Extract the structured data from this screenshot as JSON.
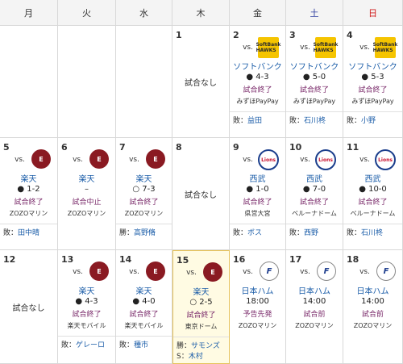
{
  "days": [
    "月",
    "火",
    "水",
    "木",
    "金",
    "土",
    "日"
  ],
  "day_colors": [
    "#333333",
    "#333333",
    "#333333",
    "#333333",
    "#333333",
    "#2f3fa0",
    "#d11b1b"
  ],
  "weeks": [
    [
      {
        "empty": true
      },
      {
        "empty": true
      },
      {
        "empty": true
      },
      {
        "day": "1",
        "none": "試合なし"
      },
      {
        "day": "2",
        "logo": "hawks",
        "logo_text": "SoftBank HAWKS",
        "vs": "vs.",
        "opp": "ソフトバンク",
        "score": "● 4-3",
        "status": "試合終了",
        "stadium": "みずほPayPay",
        "pitcher_label": "敗：",
        "pitcher": "益田"
      },
      {
        "day": "3",
        "logo": "hawks",
        "logo_text": "SoftBank HAWKS",
        "vs": "vs.",
        "opp": "ソフトバンク",
        "score": "● 5-0",
        "status": "試合終了",
        "stadium": "みずほPayPay",
        "pitcher_label": "敗：",
        "pitcher": "石川柊"
      },
      {
        "day": "4",
        "logo": "hawks",
        "logo_text": "SoftBank HAWKS",
        "vs": "vs.",
        "opp": "ソフトバンク",
        "score": "● 5-3",
        "status": "試合終了",
        "stadium": "みずほPayPay",
        "pitcher_label": "敗：",
        "pitcher": "小野"
      }
    ],
    [
      {
        "day": "5",
        "logo": "eagles",
        "logo_text": "E",
        "vs": "vs.",
        "opp": "楽天",
        "score": "● 1-2",
        "status": "試合終了",
        "stadium": "ZOZOマリン",
        "pitcher_label": "敗：",
        "pitcher": "田中晴"
      },
      {
        "day": "6",
        "logo": "eagles",
        "logo_text": "E",
        "vs": "vs.",
        "opp": "楽天",
        "score": "–",
        "status": "試合中止",
        "stadium": "ZOZOマリン"
      },
      {
        "day": "7",
        "logo": "eagles",
        "logo_text": "E",
        "vs": "vs.",
        "opp": "楽天",
        "score": "○ 7-3",
        "status": "試合終了",
        "stadium": "ZOZOマリン",
        "pitcher_label": "勝：",
        "pitcher": "高野脩"
      },
      {
        "day": "8",
        "none": "試合なし"
      },
      {
        "day": "9",
        "logo": "lions",
        "logo_text": "Lions",
        "vs": "vs.",
        "opp": "西武",
        "score": "● 1-0",
        "status": "試合終了",
        "stadium": "県営大宮",
        "pitcher_label": "敗：",
        "pitcher": "ボス"
      },
      {
        "day": "10",
        "logo": "lions",
        "logo_text": "Lions",
        "vs": "vs.",
        "opp": "西武",
        "score": "● 7-0",
        "status": "試合終了",
        "stadium": "ベルーナドーム",
        "pitcher_label": "敗：",
        "pitcher": "西野"
      },
      {
        "day": "11",
        "logo": "lions",
        "logo_text": "Lions",
        "vs": "vs.",
        "opp": "西武",
        "score": "● 10-0",
        "status": "試合終了",
        "stadium": "ベルーナドーム",
        "pitcher_label": "敗：",
        "pitcher": "石川柊"
      }
    ],
    [
      {
        "day": "12",
        "none": "試合なし"
      },
      {
        "day": "13",
        "logo": "eagles",
        "logo_text": "E",
        "vs": "vs.",
        "opp": "楽天",
        "score": "● 4-3",
        "status": "試合終了",
        "stadium": "楽天モバイル",
        "pitcher_label": "敗：",
        "pitcher": "ゲレーロ"
      },
      {
        "day": "14",
        "logo": "eagles",
        "logo_text": "E",
        "vs": "vs.",
        "opp": "楽天",
        "score": "● 4-0",
        "status": "試合終了",
        "stadium": "楽天モバイル",
        "pitcher_label": "敗：",
        "pitcher": "種市"
      },
      {
        "day": "15",
        "today": true,
        "logo": "eagles",
        "logo_text": "E",
        "vs": "vs.",
        "opp": "楽天",
        "score": "○ 2-5",
        "status": "試合終了",
        "stadium": "東京ドーム",
        "pitcher_label": "勝：",
        "pitcher": "サモンズ",
        "save_label": "S：",
        "save": "木村"
      },
      {
        "day": "16",
        "logo": "fighters",
        "logo_text": "F",
        "vs": "vs.",
        "opp": "日本ハム",
        "score": "18:00",
        "status": "予告先発",
        "stadium": "ZOZOマリン"
      },
      {
        "day": "17",
        "logo": "fighters",
        "logo_text": "F",
        "vs": "vs.",
        "opp": "日本ハム",
        "score": "14:00",
        "status": "試合前",
        "stadium": "ZOZOマリン"
      },
      {
        "day": "18",
        "logo": "fighters",
        "logo_text": "F",
        "vs": "vs.",
        "opp": "日本ハム",
        "score": "14:00",
        "status": "試合前",
        "stadium": "ZOZOマリン"
      }
    ]
  ]
}
